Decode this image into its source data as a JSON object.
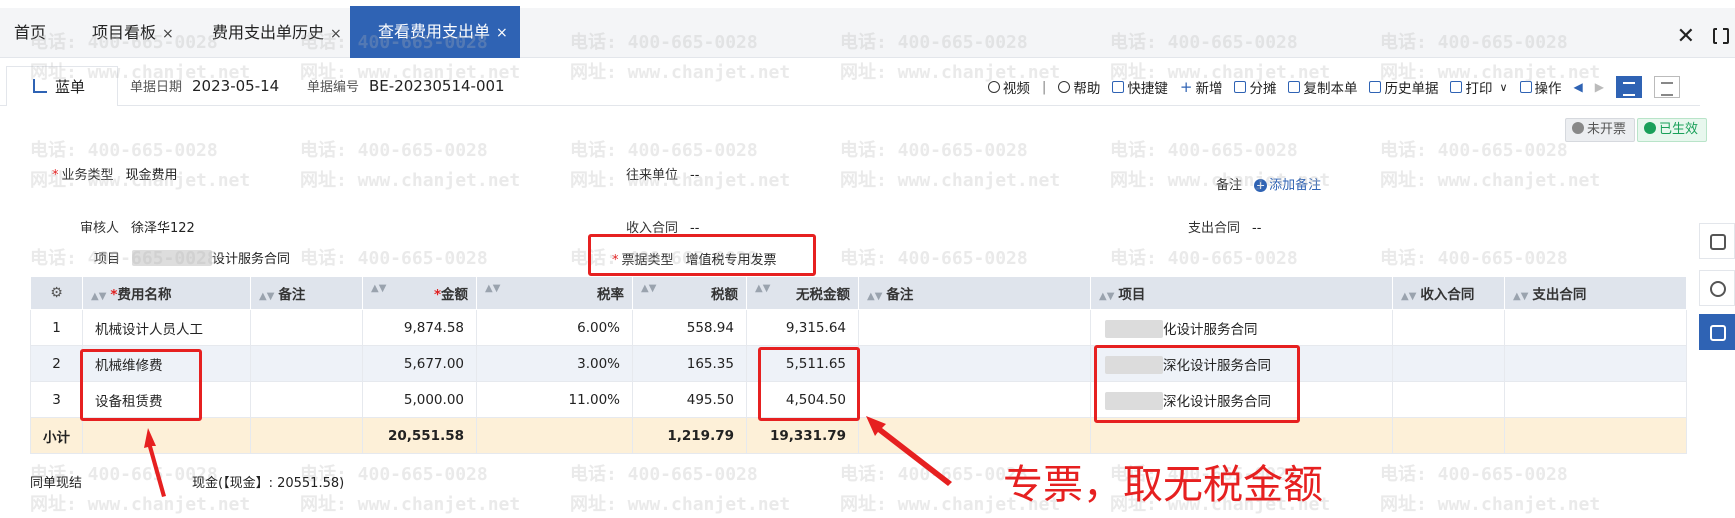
{
  "tabs": [
    {
      "label": "首页",
      "closable": false,
      "active": false
    },
    {
      "label": "项目看板",
      "closable": true,
      "active": false
    },
    {
      "label": "费用支出单历史",
      "closable": true,
      "active": false
    },
    {
      "label": "查看费用支出单",
      "closable": true,
      "active": true
    }
  ],
  "close_glyph": "×",
  "window": {
    "close": "✕"
  },
  "watermark": {
    "phone": "电话: 400-665-0028",
    "site": "网址: www.chanjet.net"
  },
  "doc": {
    "tab_label": "蓝单",
    "date_label": "单据日期",
    "date_value": "2023-05-14",
    "no_label": "单据编号",
    "no_value": "BE-20230514-001"
  },
  "toolbar": {
    "video": "视频",
    "sep": "|",
    "help": "帮助",
    "shortcut": "快捷键",
    "add": "新增",
    "split": "分摊",
    "copy": "复制本单",
    "history": "历史单据",
    "print": "打印",
    "print_caret": "∨",
    "ops": "操作",
    "prev": "◀",
    "next": "▶"
  },
  "badges": {
    "invoice": "未开票",
    "status": "已生效"
  },
  "form": {
    "business_type_label": "业务类型",
    "business_type_value": "现金费用",
    "partner_label": "往来单位",
    "partner_value": "--",
    "remark_label": "备注",
    "add_remark": "添加备注",
    "reviewer_label": "审核人",
    "reviewer_value": "徐泽华122",
    "income_contract_label": "收入合同",
    "income_contract_value": "--",
    "expense_contract_label": "支出合同",
    "expense_contract_value": "--",
    "project_label": "项目",
    "project_value": "设计服务合同",
    "bill_type_label": "票据类型",
    "bill_type_value": "增值税专用发票"
  },
  "table": {
    "headers": {
      "fee_name": "费用名称",
      "remark1": "备注",
      "amount": "金额",
      "tax_rate": "税率",
      "tax": "税额",
      "net": "无税金额",
      "remark2": "备注",
      "project": "项目",
      "income_contract": "收入合同",
      "expense_contract": "支出合同"
    },
    "rows": [
      {
        "no": "1",
        "name": "机械设计人员人工",
        "amount": "9,874.58",
        "rate": "6.00%",
        "tax": "558.94",
        "net": "9,315.64",
        "project": "化设计服务合同"
      },
      {
        "no": "2",
        "name": "机械维修费",
        "amount": "5,677.00",
        "rate": "3.00%",
        "tax": "165.35",
        "net": "5,511.65",
        "project": "深化设计服务合同"
      },
      {
        "no": "3",
        "name": "设备租赁费",
        "amount": "5,000.00",
        "rate": "11.00%",
        "tax": "495.50",
        "net": "4,504.50",
        "project": "深化设计服务合同"
      }
    ],
    "subtotal": {
      "label": "小计",
      "amount": "20,551.58",
      "tax": "1,219.79",
      "net": "19,331.79"
    }
  },
  "footer": {
    "settle_label": "同单现结",
    "settle_value": "现金(【现金】: 20551.58)"
  },
  "annotation": {
    "text": "专票，取无税金额",
    "color": "#e62020"
  },
  "colors": {
    "primary": "#2f63b4",
    "header_bg": "#dfe4ec",
    "subtotal_bg": "#fdf0d8",
    "required": "#e02020",
    "success": "#1aa05a"
  }
}
